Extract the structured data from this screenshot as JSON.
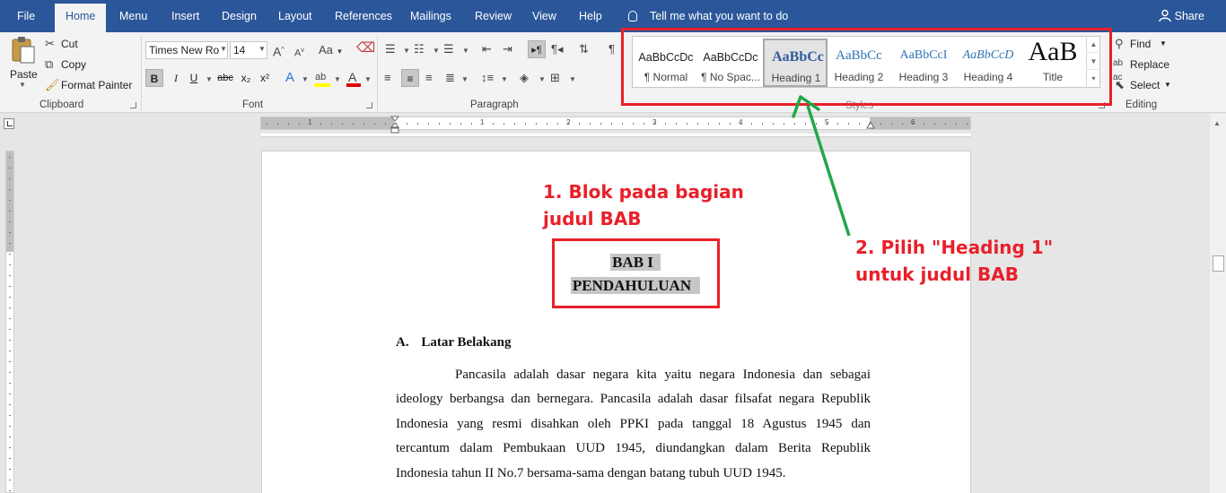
{
  "tabs": {
    "file": "File",
    "home": "Home",
    "menu": "Menu",
    "insert": "Insert",
    "design": "Design",
    "layout": "Layout",
    "references": "References",
    "mailings": "Mailings",
    "review": "Review",
    "view": "View",
    "help": "Help"
  },
  "tell_me": "Tell me what you want to do",
  "share": "Share",
  "clipboard": {
    "paste": "Paste",
    "cut": "Cut",
    "copy": "Copy",
    "format_painter": "Format Painter",
    "label": "Clipboard"
  },
  "font": {
    "name": "Times New Ro",
    "size": "14",
    "label": "Font",
    "grow": "A",
    "shrink": "A",
    "change_case": "Aa",
    "bold": "B",
    "italic": "I",
    "underline": "U",
    "strike": "abc",
    "subscript": "x₂",
    "superscript": "x²"
  },
  "paragraph": {
    "label": "Paragraph"
  },
  "styles": {
    "label": "Styles",
    "items": [
      {
        "preview": "AaBbCcDc",
        "name": "¶ Normal"
      },
      {
        "preview": "AaBbCcDc",
        "name": "¶ No Spac..."
      },
      {
        "preview": "AaBbCc",
        "name": "Heading 1"
      },
      {
        "preview": "AaBbCc",
        "name": "Heading 2"
      },
      {
        "preview": "AaBbCcI",
        "name": "Heading 3"
      },
      {
        "preview": "AaBbCcD",
        "name": "Heading 4"
      },
      {
        "preview": "AaB",
        "name": "Title"
      }
    ],
    "selected": "Heading 1"
  },
  "editing": {
    "find": "Find",
    "replace": "Replace",
    "select": "Select",
    "label": "Editing"
  },
  "ruler": {
    "numbers": [
      "1",
      "1",
      "2",
      "3",
      "4",
      "5",
      "6"
    ]
  },
  "annotations": {
    "step1_line1": "1. Blok pada bagian",
    "step1_line2": "judul BAB",
    "step2_line1": "2. Pilih \"Heading 1\"",
    "step2_line2": "untuk judul BAB"
  },
  "document": {
    "title_line1": "BAB I",
    "title_line2": "PENDAHULUAN",
    "section_num": "A.",
    "section_title": "Latar Belakang",
    "para_lines": [
      "Pancasila adalah dasar negara kita yaitu negara Indonesia dan sebagai",
      "ideology berbangsa dan bernegara. Pancasila adalah dasar filsafat negara Republik",
      "Indonesia yang resmi disahkan oleh PPKI pada tanggal 18 Agustus 1945 dan",
      "tercantum dalam Pembukaan UUD 1945, diundangkan dalam Berita Republik",
      "Indonesia tahun II No.7 bersama-sama dengan batang tubuh UUD 1945."
    ]
  },
  "colors": {
    "ribbon_blue": "#2b579a",
    "annotation_red": "#e8202a",
    "arrow_green": "#22a74a"
  }
}
